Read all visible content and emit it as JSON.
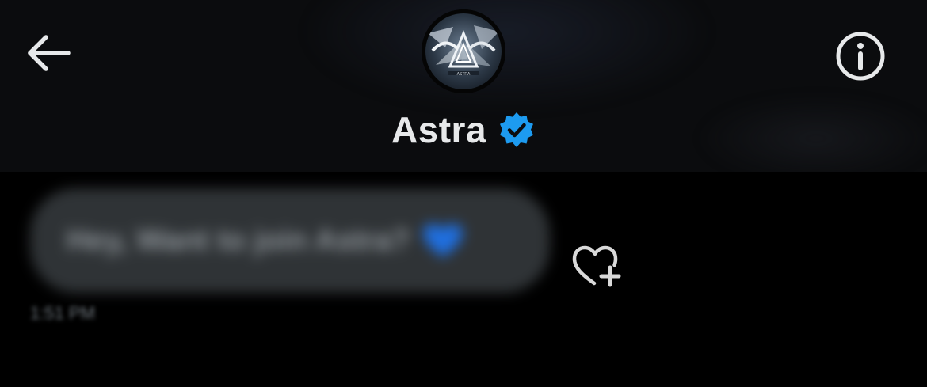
{
  "header": {
    "contact_name": "Astra",
    "verified": true,
    "back_icon": "arrow-left-icon",
    "info_icon": "info-circle-icon",
    "avatar_text": "ASTRA"
  },
  "conversation": {
    "messages": [
      {
        "text": "Hey, Want to join Astra?",
        "emoji": "blue-heart",
        "time": "1:51 PM",
        "blurred": true
      }
    ],
    "react_icon": "heart-plus-icon"
  },
  "colors": {
    "background": "#000000",
    "header_background": "#0b0c0e",
    "text_primary": "#e7e9ea",
    "verified_blue": "#1d9bf0",
    "bubble": "#2f3336",
    "icon_gray": "#d9d9d9"
  }
}
